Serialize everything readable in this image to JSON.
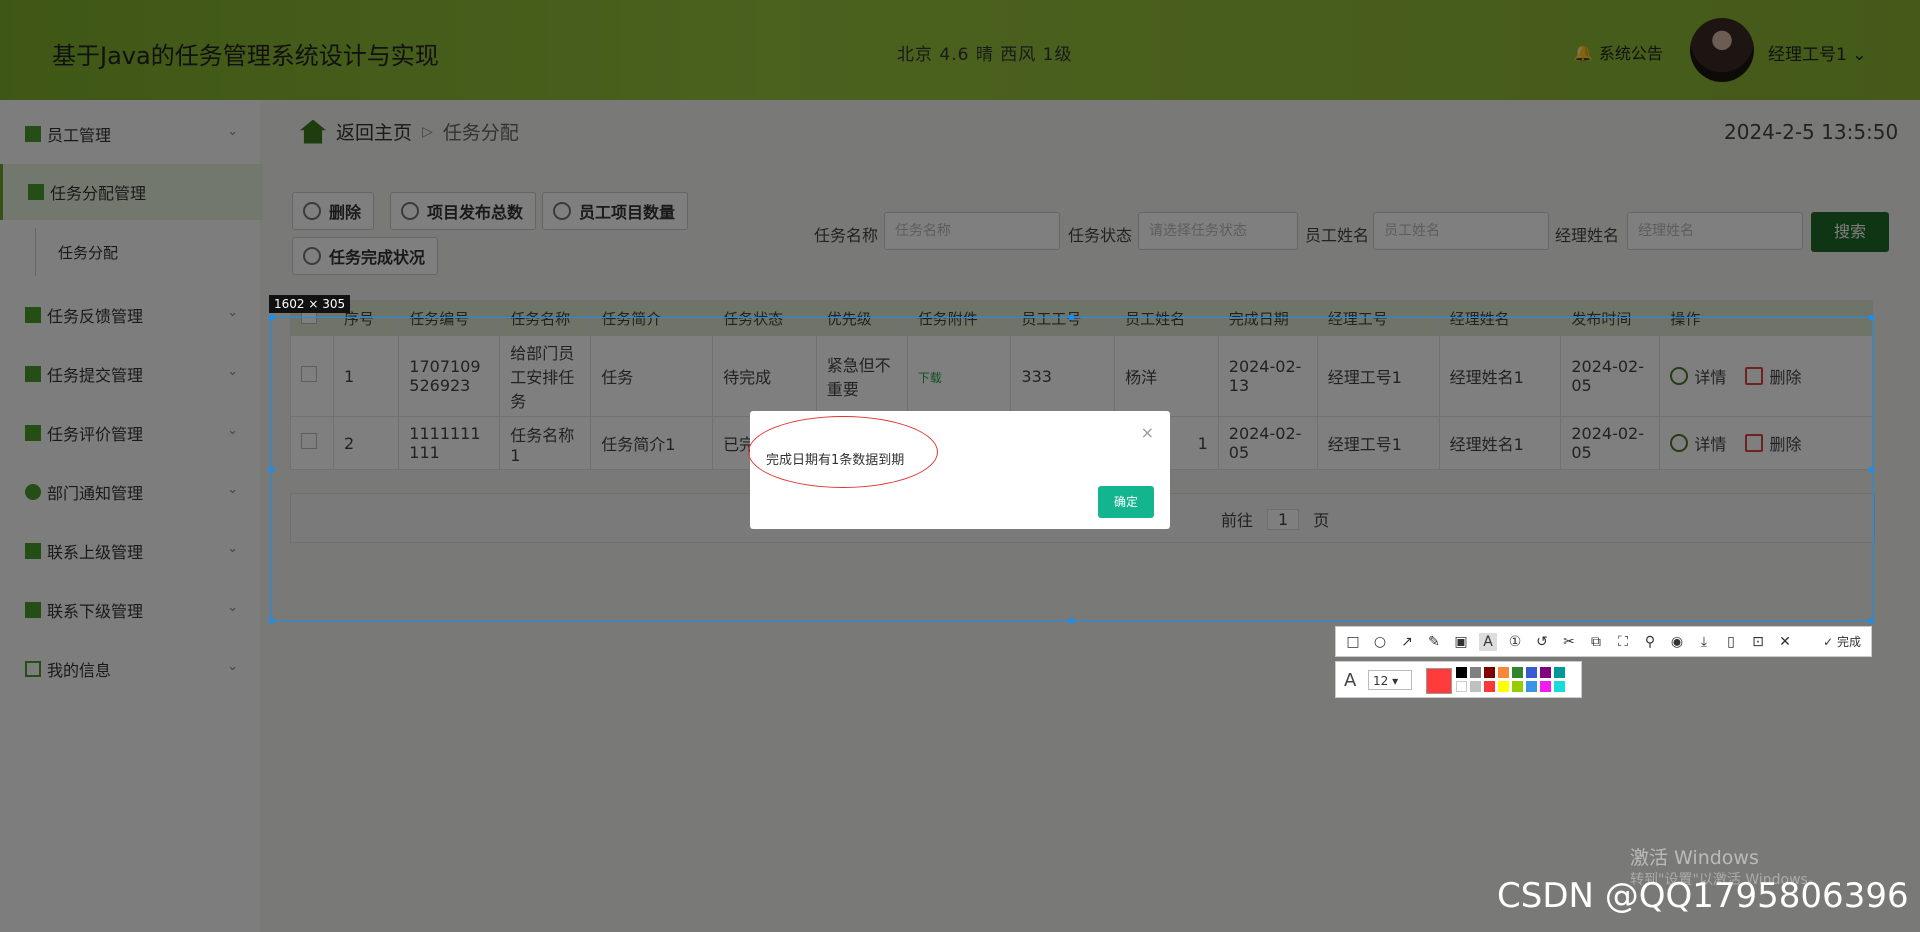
{
  "header": {
    "title": "基于Java的任务管理系统设计与实现",
    "weather": "北京 4.6  晴 西风  1级",
    "notice": "系统公告",
    "user": "经理工号1 ⌄"
  },
  "sidebar": {
    "items": [
      {
        "label": "员工管理"
      },
      {
        "label": "任务分配管理"
      },
      {
        "label": "任务反馈管理"
      },
      {
        "label": "任务提交管理"
      },
      {
        "label": "任务评价管理"
      },
      {
        "label": "部门通知管理"
      },
      {
        "label": "联系上级管理"
      },
      {
        "label": "联系下级管理"
      },
      {
        "label": "我的信息"
      }
    ],
    "sub": "任务分配"
  },
  "breadcrumb": {
    "home": "返回主页",
    "sep": "▷",
    "current": "任务分配"
  },
  "clock": "2024-2-5 13:5:50",
  "buttons": {
    "delete": "删除",
    "publish_total": "项目发布总数",
    "staff_count": "员工项目数量",
    "completion": "任务完成状况"
  },
  "search": {
    "task_name_label": "任务名称",
    "task_name_ph": "任务名称",
    "task_status_label": "任务状态",
    "task_status_ph": "请选择任务状态",
    "staff_name_label": "员工姓名",
    "staff_name_ph": "员工姓名",
    "manager_name_label": "经理姓名",
    "manager_name_ph": "经理姓名",
    "button": "搜索"
  },
  "table": {
    "headers": [
      "序号",
      "任务编号",
      "任务名称",
      "任务简介",
      "任务状态",
      "优先级",
      "任务附件",
      "员工工号",
      "员工姓名",
      "完成日期",
      "经理工号",
      "经理姓名",
      "发布时间",
      "操作"
    ],
    "rows": [
      {
        "no": "1",
        "code": "1707109526923",
        "name": "给部门员工安排任务",
        "intro": "任务",
        "status": "待完成",
        "priority": "紧急但不重要",
        "attach": "下载",
        "staff_id": "333",
        "staff_name": "杨洋",
        "finish": "2024-02-13",
        "mgr_id": "经理工号1",
        "mgr_name": "经理姓名1",
        "pub": "2024-02-05"
      },
      {
        "no": "2",
        "code": "1111111111",
        "name": "任务名称1",
        "intro": "任务简介1",
        "status": "已完成",
        "priority": "",
        "attach": "",
        "staff_id": "",
        "staff_name": "1",
        "finish": "2024-02-05",
        "mgr_id": "经理工号1",
        "mgr_name": "经理姓名1",
        "pub": "2024-02-05"
      }
    ],
    "action_detail": "详情",
    "action_delete": "删除"
  },
  "pager": {
    "goto": "前往",
    "page": "1",
    "unit": "页"
  },
  "dialog": {
    "message": "完成日期有1条数据到期",
    "close": "×",
    "ok": "确定"
  },
  "screenshot_tool": {
    "size_label": "1602 × 305",
    "done": "✓ 完成",
    "font_size": "12 ▾",
    "current_color": "#ff3b3b"
  },
  "watermark": {
    "line1": "激活 Windows",
    "line2": "转到\"设置\"以激活 Windows。"
  },
  "csdn": "CSDN @QQ1795806396"
}
